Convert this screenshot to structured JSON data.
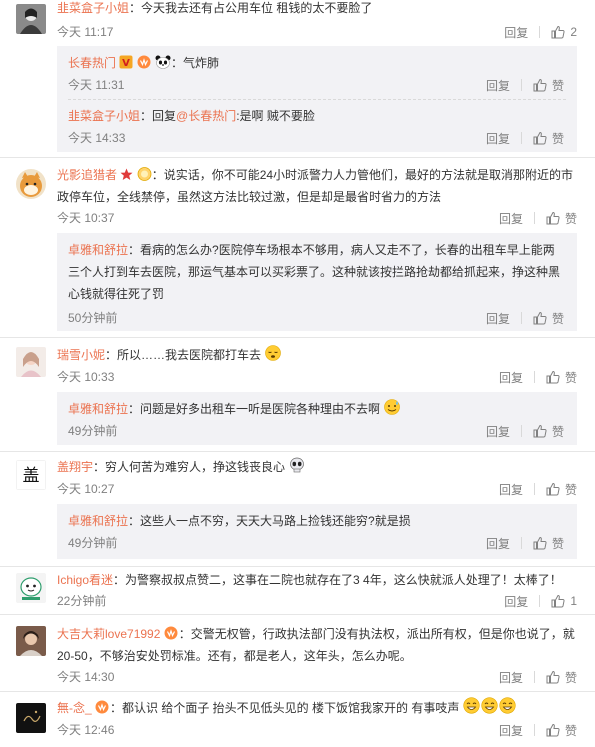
{
  "comments": [
    {
      "username": "韭菜盒子小姐",
      "text": "：今天我去还有占公用车位 租钱的太不要脸了",
      "time": "今天 11:17",
      "reply_label": "回复",
      "like_count": "2",
      "replies": [
        {
          "username": "长春热门",
          "text": "：气炸肺",
          "time": "今天 11:31",
          "reply_label": "回复",
          "like_label": "赞"
        },
        {
          "username": "韭菜盒子小姐",
          "text_prefix": "：回复",
          "mention": "@长春热门",
          "text": ":是啊 贼不要脸",
          "time": "今天 14:33",
          "reply_label": "回复",
          "like_label": "赞"
        }
      ]
    },
    {
      "username": "光影追猎者",
      "text_line1": "：说实话，你不可能24小时派警力人力管他们，最好的方法就是取消那附近的市",
      "text_line2": "政停车位，全线禁停，虽然这方法比较过激，但是却是最省时省力的方法",
      "time": "今天 10:37",
      "reply_label": "回复",
      "like_label": "赞",
      "replies": [
        {
          "username": "卓雅和舒拉",
          "text_line1": "：看病的怎么办?医院停车场根本不够用，病人又走不了，长春的出租车早上能两",
          "text_line2": "三个人打到车去医院，那运气基本可以买彩票了。这种就该按拦路抢劫都给抓起来，挣这种黑",
          "text_line3": "心钱就得往死了罚",
          "time": "50分钟前",
          "reply_label": "回复",
          "like_label": "赞"
        }
      ]
    },
    {
      "username": "瑞雪小妮",
      "text": "：所以……我去医院都打车去",
      "time": "今天 10:33",
      "reply_label": "回复",
      "like_label": "赞",
      "replies": [
        {
          "username": "卓雅和舒拉",
          "text": "：问题是好多出租车一听是医院各种理由不去啊",
          "time": "49分钟前",
          "reply_label": "回复",
          "like_label": "赞"
        }
      ]
    },
    {
      "username": "盖翔宇",
      "text": "：穷人何苦为难穷人，挣这钱丧良心",
      "time": "今天 10:27",
      "reply_label": "回复",
      "like_label": "赞",
      "replies": [
        {
          "username": "卓雅和舒拉",
          "text": "：这些人一点不穷，天天大马路上捡钱还能穷?就是损",
          "time": "49分钟前",
          "reply_label": "回复",
          "like_label": "赞"
        }
      ]
    },
    {
      "username": "Ichigo看迷",
      "text": "：为警察叔叔点赞二，这事在二院也就存在了3 4年，这么快就派人处理了！太棒了！",
      "time": "22分钟前",
      "reply_label": "回复",
      "like_count": "1"
    },
    {
      "username": "大吉大莉love71992",
      "text_line1": "：交警无权管，行政执法部门没有执法权，派出所有权，但是你也说了，就",
      "text_line2": "20-50，不够治安处罚标准。还有，都是老人，这年头，怎么办呢。",
      "time": "今天 14:30",
      "reply_label": "回复",
      "like_label": "赞"
    },
    {
      "username": "無-念_",
      "text": "：都认识 给个面子 抬头不见低头见的 楼下饭馆我家开的 有事吱声",
      "time": "今天 12:46",
      "reply_label": "回复",
      "like_label": "赞"
    }
  ],
  "badges": {
    "v_badge": "V"
  },
  "colors": {
    "username": "#eb7350",
    "meta": "#808080",
    "reply_bg": "#f2f2f5",
    "v_badge": "#f5a623",
    "star": "#e03a3a"
  }
}
